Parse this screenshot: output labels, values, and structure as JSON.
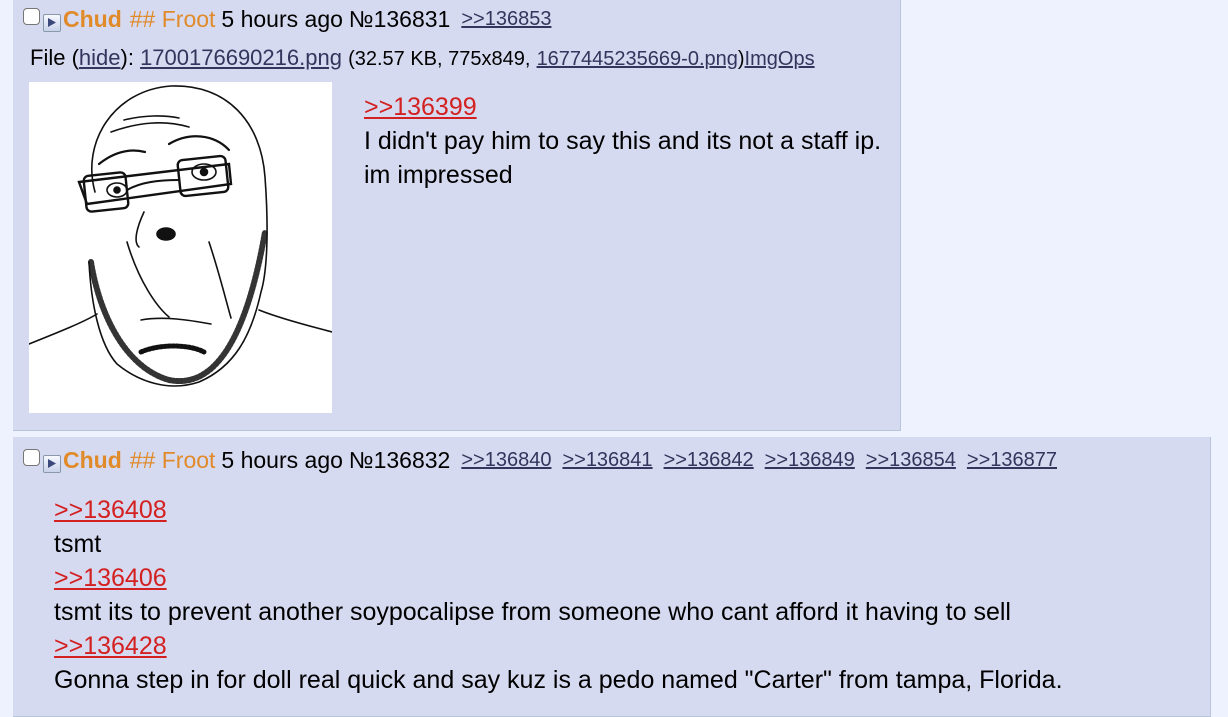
{
  "posts": [
    {
      "name": "Chud",
      "tripcode": "## Froot",
      "date": "5 hours ago",
      "number": "№136831",
      "backlinks": [
        ">>136853"
      ],
      "file": {
        "label": "File",
        "hide": "hide",
        "filename": "1700176690216.png",
        "meta": "(32.57 KB, 775x849,",
        "original_name": "1677445235669-0.png",
        "imgops": "ImgOps"
      },
      "message": [
        {
          "type": "quote",
          "text": ">>136399"
        },
        {
          "type": "text",
          "text": "I didn't pay him to say this and its not a staff ip. im impressed"
        }
      ]
    },
    {
      "name": "Chud",
      "tripcode": "## Froot",
      "date": "5 hours ago",
      "number": "№136832",
      "backlinks": [
        ">>136840",
        ">>136841",
        ">>136842",
        ">>136849",
        ">>136854",
        ">>136877"
      ],
      "message": [
        {
          "type": "quote",
          "text": ">>136408"
        },
        {
          "type": "text",
          "text": "tsmt"
        },
        {
          "type": "quote",
          "text": ">>136406"
        },
        {
          "type": "text",
          "text": "tsmt its to prevent another soypocalipse from someone who cant afford it having to sell"
        },
        {
          "type": "quote",
          "text": ">>136428"
        },
        {
          "type": "text",
          "text": "Gonna step in for doll real quick and say kuz is a pedo named \"Carter\" from tampa, Florida."
        }
      ]
    }
  ],
  "icons": {
    "post_menu": "triangle-right-icon",
    "thumbnail": "soyjak-glasses-drawing"
  },
  "colors": {
    "page_bg": "#eef2ff",
    "post_bg": "#d6daf0",
    "name": "#e08a2a",
    "quotelink": "#d32020",
    "backlink": "#34345c"
  }
}
